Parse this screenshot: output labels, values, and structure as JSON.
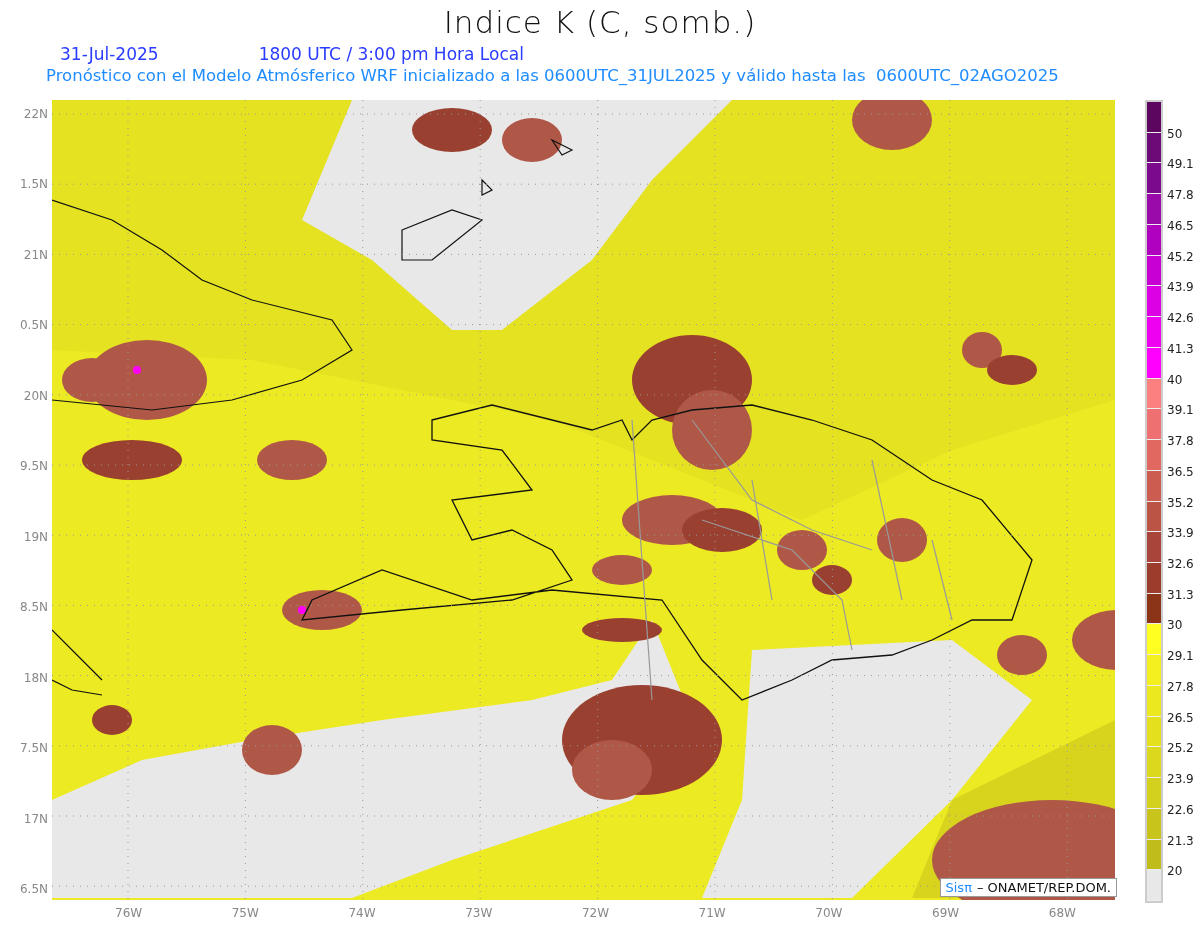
{
  "title": "Indice K (C, somb.)",
  "date": "31-Jul-2025",
  "time": "1800 UTC / 3:00 pm Hora Local",
  "subtitle": "Pronóstico con el Modelo Atmósferico WRF inicializado a las 0600UTC_31JUL2025 y válido hasta las  0600UTC_02AGO2025",
  "lat_labels": [
    "22N",
    "1.5N",
    "21N",
    "0.5N",
    "20N",
    "9.5N",
    "19N",
    "8.5N",
    "18N",
    "7.5N",
    "17N",
    "6.5N"
  ],
  "lon_labels": [
    "76W",
    "75W",
    "74W",
    "73W",
    "72W",
    "71W",
    "70W",
    "69W",
    "68W"
  ],
  "credit": {
    "brand": "Sisπ",
    "text": "– ONAMET/REP.DOM."
  },
  "legend": [
    {
      "color": "#5c0660",
      "label": "50"
    },
    {
      "color": "#6c0a78",
      "label": "49.1"
    },
    {
      "color": "#7c0a8c",
      "label": "47.8"
    },
    {
      "color": "#9a0aaa",
      "label": "46.5"
    },
    {
      "color": "#b000c0",
      "label": "45.2"
    },
    {
      "color": "#c800d4",
      "label": "43.9"
    },
    {
      "color": "#dc00e4",
      "label": "42.6"
    },
    {
      "color": "#ee00f0",
      "label": "41.3"
    },
    {
      "color": "#ff00ff",
      "label": "40"
    },
    {
      "color": "#fc8080",
      "label": "39.1"
    },
    {
      "color": "#ee7070",
      "label": "37.8"
    },
    {
      "color": "#e06860",
      "label": "36.5"
    },
    {
      "color": "#cc5c50",
      "label": "35.2"
    },
    {
      "color": "#bb5444",
      "label": "33.9"
    },
    {
      "color": "#a8443a",
      "label": "32.6"
    },
    {
      "color": "#9c3c2c",
      "label": "31.3"
    },
    {
      "color": "#8c3418",
      "label": "30"
    },
    {
      "color": "#ffff22",
      "label": "29.1"
    },
    {
      "color": "#f4f020",
      "label": "27.8"
    },
    {
      "color": "#ece820",
      "label": "26.5"
    },
    {
      "color": "#e4e01e",
      "label": "25.2"
    },
    {
      "color": "#dcd81e",
      "label": "23.9"
    },
    {
      "color": "#d4d01e",
      "label": "22.6"
    },
    {
      "color": "#c8c41c",
      "label": "21.3"
    },
    {
      "color": "#c0bc1c",
      "label": "20"
    },
    {
      "color": "#e8e8e8"
    }
  ]
}
